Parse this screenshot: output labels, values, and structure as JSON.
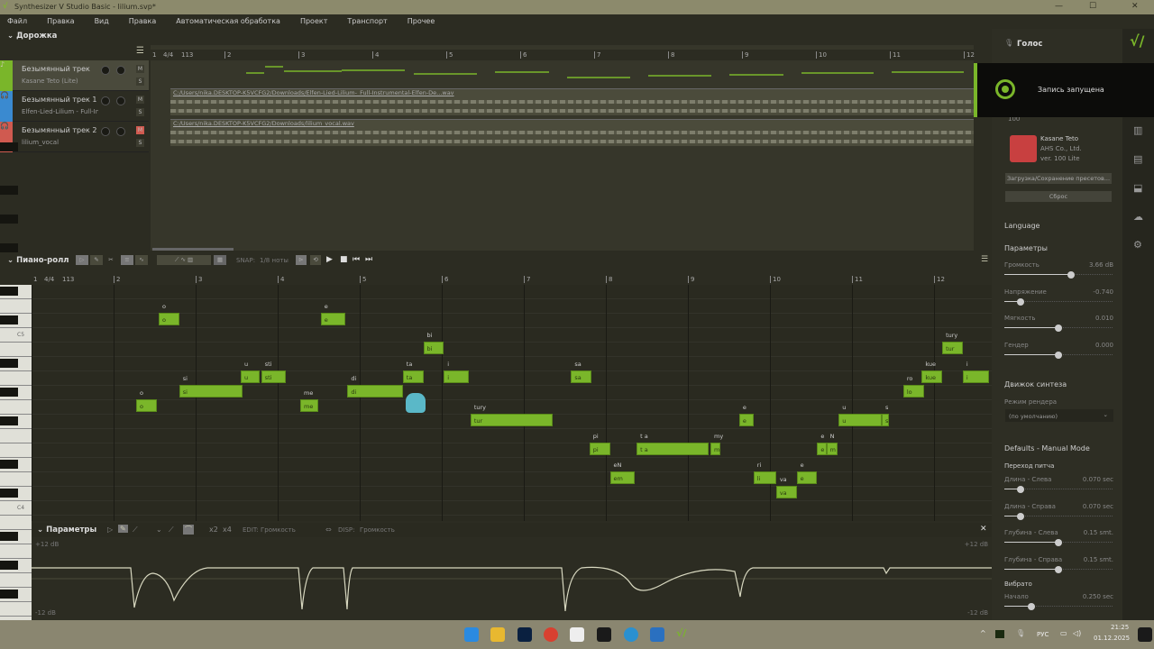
{
  "window": {
    "title": "Synthesizer V Studio Basic - lilium.svp*"
  },
  "menu": [
    "Файл",
    "Правка",
    "Вид",
    "Правка",
    "Автоматическая обработка",
    "Проект",
    "Транспорт",
    "Прочее"
  ],
  "tracks_panel": {
    "title": "Дорожка",
    "tracks": [
      {
        "name": "Безымянный трек",
        "sub": "Kasane Teto (Lite)",
        "color": "#7ab62a",
        "mute_active": false
      },
      {
        "name": "Безымянный трек 1",
        "sub": "Elfen-Lied-Lilium - Full-In...",
        "color": "#3a8ad0",
        "mute_active": false
      },
      {
        "name": "Безымянный трек 2",
        "sub": "lilium_vocal",
        "color": "#d05a50",
        "mute_active": true
      }
    ],
    "mute_label": "M",
    "solo_label": "S",
    "ruler": {
      "start": "1",
      "time_sig": "4/4",
      "tempo": "113",
      "measures": [
        "2",
        "3",
        "4",
        "5",
        "6",
        "7",
        "8",
        "9",
        "10",
        "11",
        "12"
      ]
    },
    "clips": [
      "C:/Users/nika.DESKTOP-K5VCFG2/Downloads/Elfen-Lied-Lilium-_Full-Instrumental-Elfen-De...wav",
      "C:/Users/nika.DESKTOP-K5VCFG2/Downloads/lilium_vocal.wav"
    ]
  },
  "piano_roll": {
    "title": "Пиано-ролл",
    "snap_label": "SNAP:",
    "snap_value": "1/8 ноты",
    "ruler": {
      "start": "1",
      "time_sig": "4/4",
      "tempo": "113",
      "measures": [
        "2",
        "3",
        "4",
        "5",
        "6",
        "7",
        "8",
        "9",
        "10",
        "11",
        "12"
      ]
    },
    "key_labels": {
      "c5": "C5",
      "c4": "C4"
    },
    "notes": [
      {
        "lyric": "o",
        "ph": "o",
        "start": 5.1,
        "dur": 1,
        "pitch": 67
      },
      {
        "lyric": "o",
        "ph": "o",
        "start": 6.2,
        "dur": 1,
        "pitch": 73
      },
      {
        "lyric": "si",
        "ph": "si",
        "start": 7.2,
        "dur": 3.1,
        "pitch": 68
      },
      {
        "lyric": "u",
        "ph": "u",
        "start": 10.2,
        "dur": 0.9,
        "pitch": 69
      },
      {
        "lyric": "sti",
        "ph": "sti",
        "start": 11.2,
        "dur": 1.2,
        "pitch": 69
      },
      {
        "lyric": "me",
        "ph": "me",
        "start": 13.1,
        "dur": 0.9,
        "pitch": 67
      },
      {
        "lyric": "e",
        "ph": "e",
        "start": 14.1,
        "dur": 1.2,
        "pitch": 73
      },
      {
        "lyric": "di",
        "ph": "di",
        "start": 15.4,
        "dur": 2.7,
        "pitch": 68
      },
      {
        "lyric": "ta",
        "ph": "ta",
        "start": 18.1,
        "dur": 1,
        "pitch": 69
      },
      {
        "lyric": "bi",
        "ph": "bi",
        "start": 19.1,
        "dur": 1,
        "pitch": 71
      },
      {
        "lyric": "i",
        "ph": "i",
        "start": 20.1,
        "dur": 1.2,
        "pitch": 69
      },
      {
        "lyric": "tury",
        "ph": "tur",
        "start": 21.4,
        "dur": 4,
        "pitch": 66
      },
      {
        "lyric": "sa",
        "ph": "sa",
        "start": 26.3,
        "dur": 1,
        "pitch": 69
      },
      {
        "lyric": "pi",
        "ph": "pi",
        "start": 27.2,
        "dur": 1,
        "pitch": 64
      },
      {
        "lyric": "eN",
        "ph": "em",
        "start": 28.2,
        "dur": 1.2,
        "pitch": 62
      },
      {
        "lyric": "t a",
        "ph": "t a",
        "start": 29.5,
        "dur": 3.5,
        "pitch": 64
      },
      {
        "lyric": "my",
        "ph": "m",
        "start": 33.1,
        "dur": 0.5,
        "pitch": 64
      },
      {
        "lyric": "e",
        "ph": "e",
        "start": 34.5,
        "dur": 0.7,
        "pitch": 66
      },
      {
        "lyric": "ri",
        "ph": "li",
        "start": 35.2,
        "dur": 1.1,
        "pitch": 62
      },
      {
        "lyric": "va",
        "ph": "va",
        "start": 36.3,
        "dur": 1,
        "pitch": 61
      },
      {
        "lyric": "e",
        "ph": "e",
        "start": 37.3,
        "dur": 1,
        "pitch": 62
      },
      {
        "lyric": "e",
        "ph": "e",
        "start": 38.3,
        "dur": 0.45,
        "pitch": 64
      },
      {
        "lyric": "N",
        "ph": "m",
        "start": 38.75,
        "dur": 0.55,
        "pitch": 64
      },
      {
        "lyric": "u",
        "ph": "u",
        "start": 39.35,
        "dur": 2.1,
        "pitch": 66
      },
      {
        "lyric": "s",
        "ph": "s",
        "start": 41.45,
        "dur": 0.35,
        "pitch": 66
      },
      {
        "lyric": "ro",
        "ph": "lo",
        "start": 42.5,
        "dur": 1,
        "pitch": 68
      },
      {
        "lyric": "kue",
        "ph": "kue",
        "start": 43.4,
        "dur": 1,
        "pitch": 69
      },
      {
        "lyric": "tury",
        "ph": "tur",
        "start": 44.4,
        "dur": 1,
        "pitch": 71
      },
      {
        "lyric": "i",
        "ph": "i",
        "start": 45.4,
        "dur": 1.3,
        "pitch": 69
      }
    ]
  },
  "params_panel": {
    "title": "Параметры",
    "x2": "x2",
    "x4": "x4",
    "edit_label": "EDIT:",
    "edit_value": "Громкость",
    "disp_label": "DISP:",
    "disp_value": "Громкость",
    "top_db": "+12 dB",
    "bottom_db": "-12 dB"
  },
  "right_panel": {
    "title": "Голос",
    "preset_value": "100",
    "voice": {
      "name": "Kasane Teto",
      "company": "AHS Co., Ltd.",
      "version": "ver. 100 Lite"
    },
    "load_presets": "Загрузка/Сохранение пресетов...",
    "reset": "Сброс",
    "language": "Language",
    "params_title": "Параметры",
    "params": [
      {
        "label": "Громкость",
        "value": "3.66 dB",
        "pos": 0.62
      },
      {
        "label": "Напряжение",
        "value": "-0.740",
        "pos": 0.15
      },
      {
        "label": "Мягкость",
        "value": "0.010",
        "pos": 0.5
      },
      {
        "label": "Гендер",
        "value": "0.000",
        "pos": 0.5
      }
    ],
    "engine_title": "Движок синтеза",
    "render_mode_label": "Режим рендера",
    "render_mode_value": "(по умолчанию)",
    "defaults_title": "Defaults - Manual Mode",
    "pitch_transition": "Переход питча",
    "defaults": [
      {
        "label": "Длина - Слева",
        "value": "0.070 sec",
        "pos": 0.15
      },
      {
        "label": "Длина - Справа",
        "value": "0.070 sec",
        "pos": 0.15
      },
      {
        "label": "Глубина - Слева",
        "value": "0.15 smt.",
        "pos": 0.5
      },
      {
        "label": "Глубина - Справа",
        "value": "0.15 smt.",
        "pos": 0.5
      }
    ],
    "vibrato_title": "Вибрато",
    "vibrato": [
      {
        "label": "Начало",
        "value": "0.250 sec",
        "pos": 0.25
      }
    ]
  },
  "toast": {
    "text": "Запись запущена"
  },
  "taskbar": {
    "lang": "РУС",
    "time": "21:25",
    "date": "01.12.2025"
  }
}
